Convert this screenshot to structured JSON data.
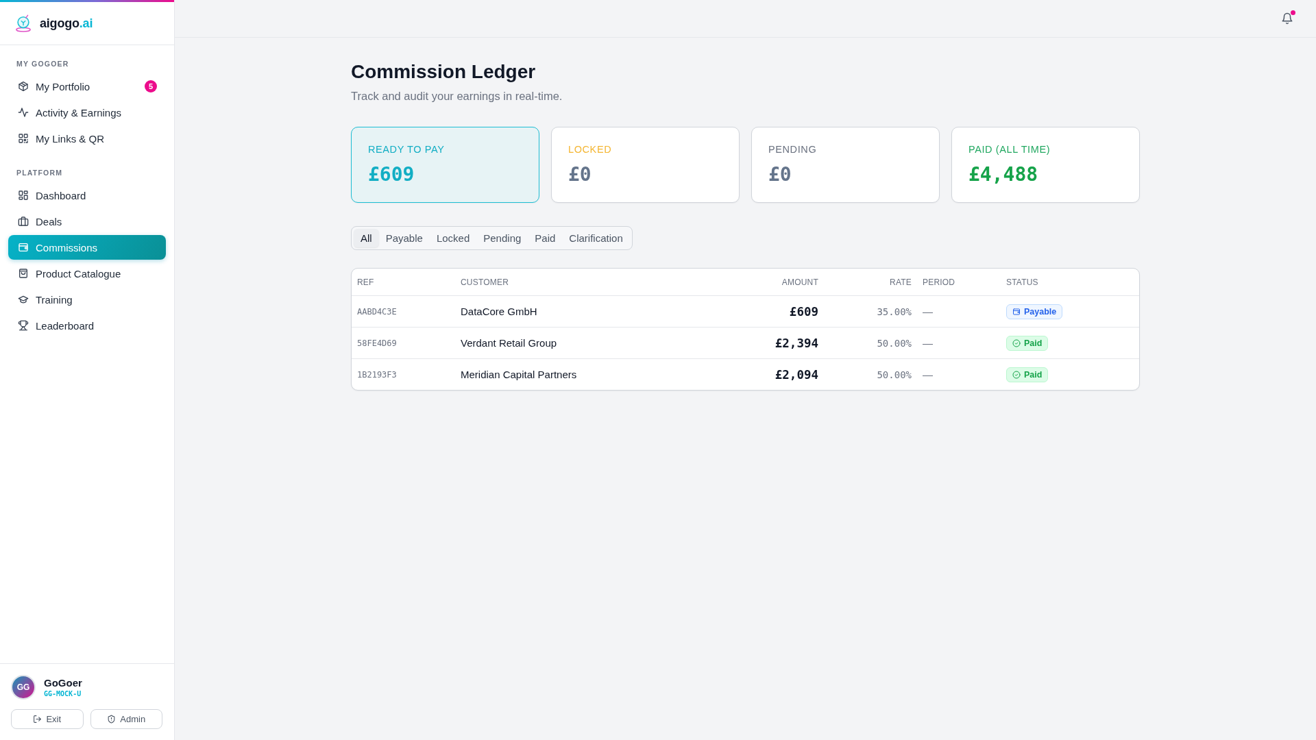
{
  "sidebar": {
    "brand": {
      "name": "aigogo",
      "suffix": ".ai"
    },
    "sections": [
      {
        "heading": "MY GOGOER",
        "items": [
          {
            "label": "My Portfolio",
            "badge": "5",
            "selected": false
          },
          {
            "label": "Activity & Earnings",
            "selected": false
          },
          {
            "label": "My Links & QR",
            "selected": false
          }
        ]
      },
      {
        "heading": "PLATFORM",
        "items": [
          {
            "label": "Dashboard",
            "selected": false
          },
          {
            "label": "Deals",
            "selected": false
          },
          {
            "label": "Commissions",
            "selected": true
          },
          {
            "label": "Product Catalogue",
            "selected": false
          },
          {
            "label": "Training",
            "selected": false
          },
          {
            "label": "Leaderboard",
            "selected": false
          }
        ]
      }
    ],
    "user": {
      "initials": "GG",
      "name": "GoGoer",
      "code": "GG-MOCK-U"
    },
    "actions": [
      "Exit",
      "Admin"
    ]
  },
  "top_bar": {
    "notifications_unread": true
  },
  "page": {
    "title": "Commission Ledger",
    "subtitle": "Track and audit your earnings in real-time."
  },
  "summary_cards": [
    {
      "label": "READY TO PAY",
      "value": "£609",
      "kind": "payable"
    },
    {
      "label": "LOCKED",
      "value": "£0",
      "kind": "locked"
    },
    {
      "label": "PENDING",
      "value": "£0",
      "kind": "pending"
    },
    {
      "label": "PAID (ALL TIME)",
      "value": "£4,488",
      "kind": "paid"
    }
  ],
  "filter_tabs": [
    {
      "label": "All",
      "selected": true
    },
    {
      "label": "Payable",
      "selected": false
    },
    {
      "label": "Locked",
      "selected": false
    },
    {
      "label": "Pending",
      "selected": false
    },
    {
      "label": "Paid",
      "selected": false
    },
    {
      "label": "Clarification",
      "selected": false
    }
  ],
  "table": {
    "columns": [
      "REF",
      "CUSTOMER",
      "AMOUNT",
      "RATE",
      "PERIOD",
      "STATUS"
    ],
    "rows": [
      {
        "ref": "AABD4C3E",
        "customer": "DataCore GmbH",
        "amount": "£609",
        "rate": "35.00%",
        "period": "—",
        "status": {
          "label": "Payable",
          "kind": "payable"
        }
      },
      {
        "ref": "58FE4D69",
        "customer": "Verdant Retail Group",
        "amount": "£2,394",
        "rate": "50.00%",
        "period": "—",
        "status": {
          "label": "Paid",
          "kind": "paid"
        }
      },
      {
        "ref": "1B2193F3",
        "customer": "Meridian Capital Partners",
        "amount": "£2,094",
        "rate": "50.00%",
        "period": "—",
        "status": {
          "label": "Paid",
          "kind": "paid"
        }
      }
    ]
  }
}
